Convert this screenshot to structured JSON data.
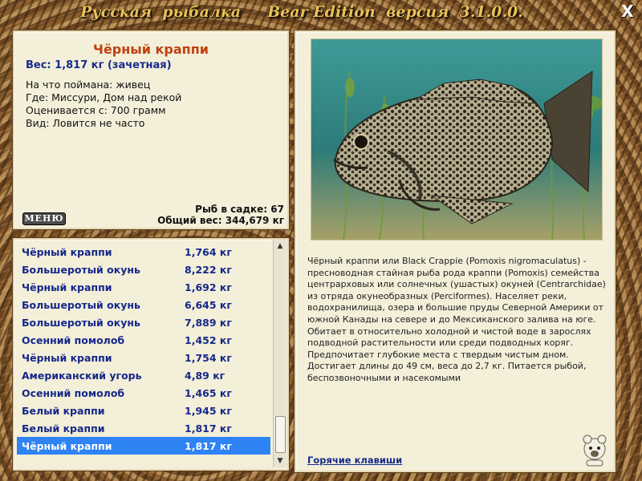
{
  "app": {
    "title": "Русская  рыбалка     Bear Edition  версия  3.1.0.0.",
    "close_label": "X"
  },
  "catch": {
    "name": "Чёрный краппи",
    "weight": "Вес: 1,817 кг (зачетная)",
    "bait": "На что поймана: живец",
    "location": "Где: Миссури, Дом над рекой",
    "valued_from": "Оценивается с: 700 грамм",
    "rarity": "Вид: Ловится не часто",
    "menu_label": "МЕНЮ",
    "fish_in_keepnet": "Рыб в садке: 67",
    "total_weight": "Общий вес: 344,679 кг"
  },
  "catch_list": [
    {
      "name": "Чёрный краппи",
      "weight": "1,764 кг"
    },
    {
      "name": "Большеротый окунь",
      "weight": "8,222 кг"
    },
    {
      "name": "Чёрный краппи",
      "weight": "1,692 кг"
    },
    {
      "name": "Большеротый окунь",
      "weight": "6,645 кг"
    },
    {
      "name": "Большеротый окунь",
      "weight": "7,889 кг"
    },
    {
      "name": "Осенний помолоб",
      "weight": "1,452 кг"
    },
    {
      "name": "Чёрный краппи",
      "weight": "1,754 кг"
    },
    {
      "name": "Американский угорь",
      "weight": "4,89 кг"
    },
    {
      "name": "Осенний помолоб",
      "weight": "1,465 кг"
    },
    {
      "name": "Белый краппи",
      "weight": "1,945 кг"
    },
    {
      "name": "Белый краппи",
      "weight": "1,817 кг"
    },
    {
      "name": "Чёрный краппи",
      "weight": "1,817 кг",
      "selected": true
    }
  ],
  "description": "Чёрный краппи или Black Crappie (Pomoxis nigromaculatus) - пресноводная стайная рыба рода краппи (Pomoxis) семейства центрарховых или солнечных (ушастых) окуней (Centrarchidae) из отряда окунеобразных (Perciformes). Населяет реки, водохранилища, озера и большие пруды Северной Америки от южной Канады на севере и до Мексиканского залива на юге. Обитает в относительно холодной и чистой воде в зарослях подводной растительности или среди подводных коряг. Предпочитает глубокие места с твердым чистым дном. Достигает длины до 49 см, веса до 2,7 кг. Питается рыбой, беспозвоночными и насекомыми",
  "hotkeys_label": "Горячие клавиши",
  "icons": {
    "close": "close-icon",
    "bear": "bear-logo-icon",
    "scroll_up": "scroll-up-arrow-icon",
    "scroll_down": "scroll-down-arrow-icon"
  },
  "colors": {
    "fish_name": "#c0400e",
    "list_text": "#16288a",
    "selection": "#2e83f5"
  }
}
